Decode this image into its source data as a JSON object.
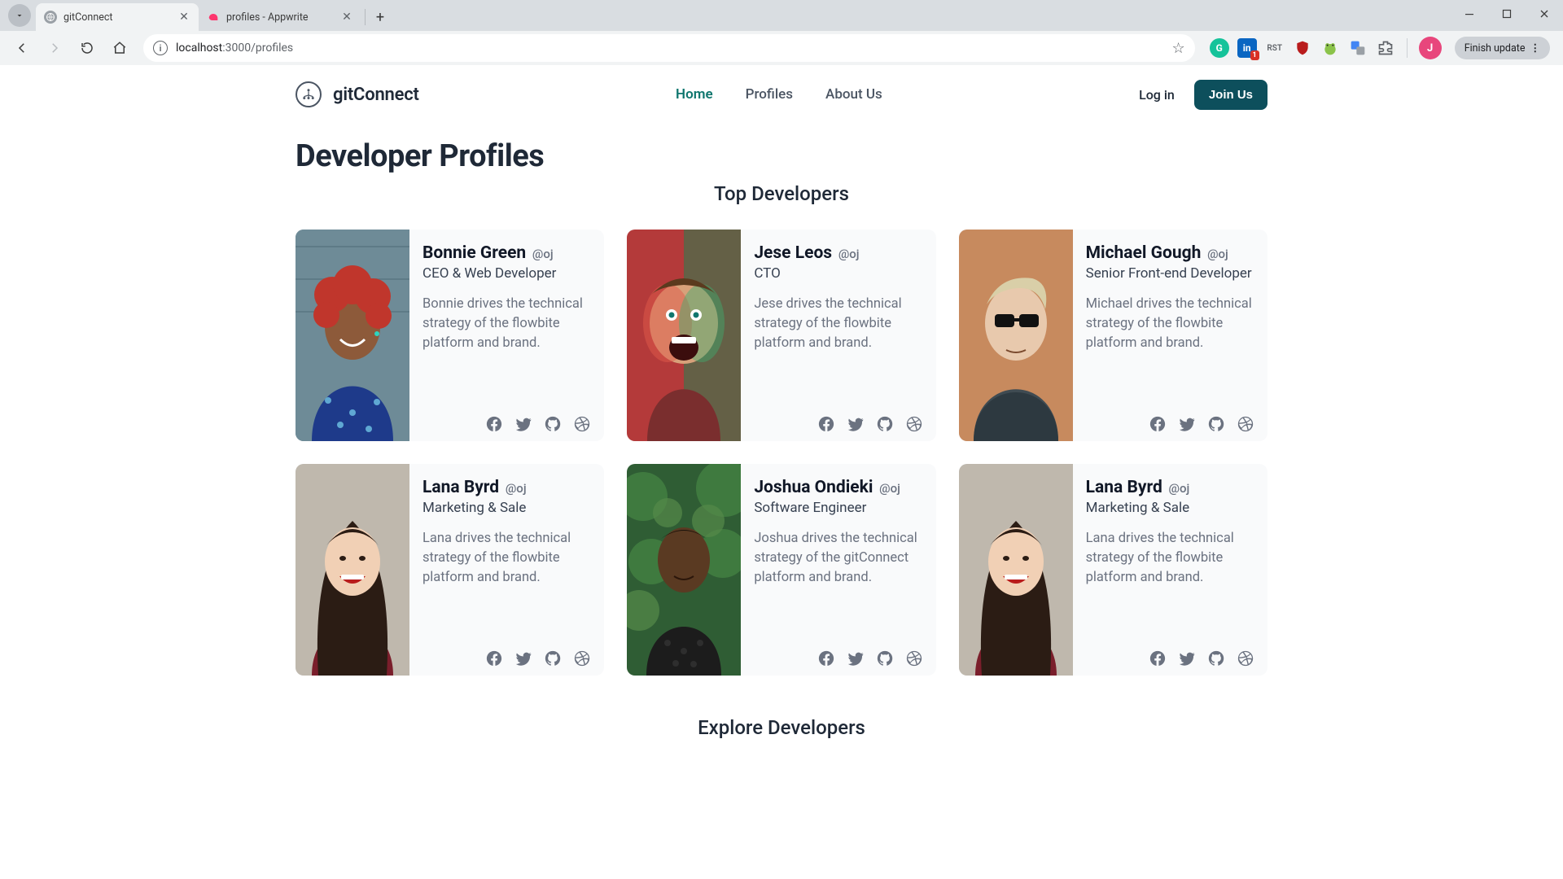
{
  "browser": {
    "tabs": [
      {
        "title": "gitConnect",
        "active": true
      },
      {
        "title": "profiles - Appwrite",
        "active": false
      }
    ],
    "url_host": "localhost",
    "url_port_path": ":3000/profiles",
    "finish_update_label": "Finish update",
    "extensions": {
      "linkedin_badge": "1",
      "rst_label": "RST",
      "avatar_letter": "J"
    }
  },
  "site": {
    "brand": "gitConnect",
    "nav": {
      "home": "Home",
      "profiles": "Profiles",
      "about": "About Us"
    },
    "login_label": "Log in",
    "join_label": "Join Us"
  },
  "page": {
    "heading": "Developer Profiles",
    "top_section_title": "Top Developers",
    "explore_section_title": "Explore Developers"
  },
  "developers": [
    {
      "name": "Bonnie Green",
      "handle": "@oj",
      "role": "CEO & Web Developer",
      "bio": "Bonnie drives the technical strategy of the flowbite platform and brand.",
      "avatar": "bonnie"
    },
    {
      "name": "Jese Leos",
      "handle": "@oj",
      "role": "CTO",
      "bio": "Jese drives the technical strategy of the flowbite platform and brand.",
      "avatar": "jese"
    },
    {
      "name": "Michael Gough",
      "handle": "@oj",
      "role": "Senior Front-end Developer",
      "bio": "Michael drives the technical strategy of the flowbite platform and brand.",
      "avatar": "michael"
    },
    {
      "name": "Lana Byrd",
      "handle": "@oj",
      "role": "Marketing & Sale",
      "bio": "Lana drives the technical strategy of the flowbite platform and brand.",
      "avatar": "lana"
    },
    {
      "name": "Joshua Ondieki",
      "handle": "@oj",
      "role": "Software Engineer",
      "bio": "Joshua drives the technical strategy of the gitConnect platform and brand.",
      "avatar": "joshua"
    },
    {
      "name": "Lana Byrd",
      "handle": "@oj",
      "role": "Marketing & Sale",
      "bio": "Lana drives the technical strategy of the flowbite platform and brand.",
      "avatar": "lana"
    }
  ],
  "social_icons": [
    "facebook",
    "twitter",
    "github",
    "dribbble"
  ]
}
